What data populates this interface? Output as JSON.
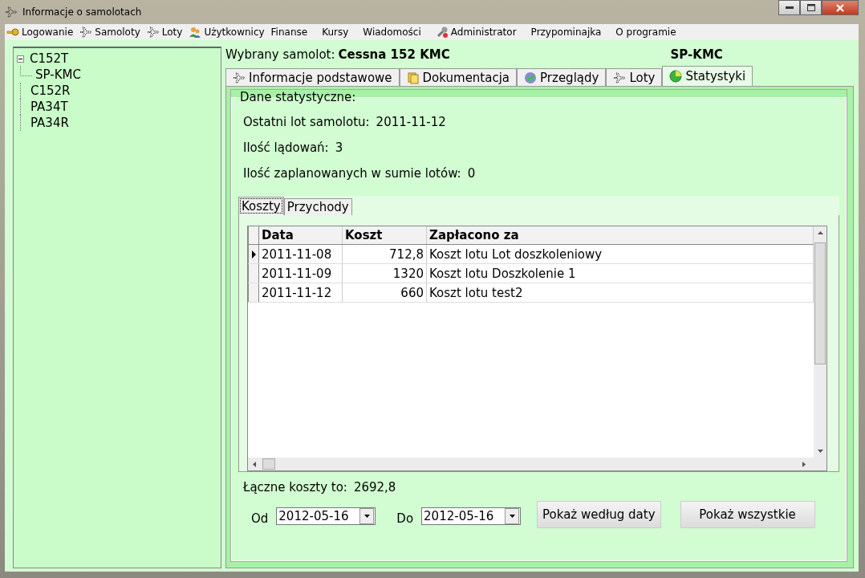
{
  "window": {
    "title": "Informacje o samolotach"
  },
  "menu": [
    {
      "label": "Logowanie",
      "kind": "key"
    },
    {
      "label": "Samoloty",
      "kind": "plane"
    },
    {
      "label": "Loty",
      "kind": "plane"
    },
    {
      "label": "Użytkownicy",
      "kind": "users"
    },
    {
      "label": "Finanse",
      "kind": "plain"
    },
    {
      "label": "Kursy",
      "kind": "plain"
    },
    {
      "label": "Wiadomości",
      "kind": "plain"
    },
    {
      "label": "Administrator",
      "kind": "wrench"
    },
    {
      "label": "Przypominajka",
      "kind": "plain"
    },
    {
      "label": "O programie",
      "kind": "plain"
    }
  ],
  "tree": [
    {
      "label": "C152T",
      "expanded": true,
      "children": [
        {
          "label": "SP-KMC"
        }
      ]
    },
    {
      "label": "C152R"
    },
    {
      "label": "PA34T"
    },
    {
      "label": "PA34R"
    }
  ],
  "header": {
    "label": "Wybrany samolot:",
    "aircraft": "Cessna 152 KMC",
    "registration": "SP-KMC"
  },
  "tabs": [
    {
      "label": "Informacje podstawowe",
      "kind": "plane",
      "selected": false
    },
    {
      "label": "Dokumentacja",
      "kind": "docs",
      "selected": false
    },
    {
      "label": "Przeglądy",
      "kind": "check",
      "selected": false
    },
    {
      "label": "Loty",
      "kind": "plane",
      "selected": false
    },
    {
      "label": "Statystyki",
      "kind": "pie",
      "selected": true
    }
  ],
  "stats": {
    "legend": "Dane statystyczne:",
    "lines": [
      {
        "label": "Ostatni lot samolotu:",
        "value": "2011-11-12"
      },
      {
        "label": "Ilość lądowań:",
        "value": "3"
      },
      {
        "label": "Ilość zaplanowanych w sumie lotów:",
        "value": "0"
      }
    ]
  },
  "subtabs": [
    {
      "label": "Koszty",
      "selected": true
    },
    {
      "label": "Przychody",
      "selected": false
    }
  ],
  "table": {
    "columns": [
      "Data",
      "Koszt",
      "Zapłacono za"
    ],
    "rows": [
      {
        "selected": true,
        "cells": [
          "2011-11-08",
          "712,8",
          "Koszt lotu Lot doszkoleniowy"
        ]
      },
      {
        "selected": false,
        "cells": [
          "2011-11-09",
          "1320",
          "Koszt lotu Doszkolenie 1"
        ]
      },
      {
        "selected": false,
        "cells": [
          "2011-11-12",
          "660",
          "Koszt lotu test2"
        ]
      }
    ]
  },
  "total": {
    "label": "Łączne koszty to:",
    "value": "2692,8"
  },
  "filter": {
    "from_label": "Od",
    "from": "2012-05-16",
    "to_label": "Do",
    "to": "2012-05-16"
  },
  "buttons": [
    "Pokaż według daty",
    "Pokaż wszystkie"
  ]
}
